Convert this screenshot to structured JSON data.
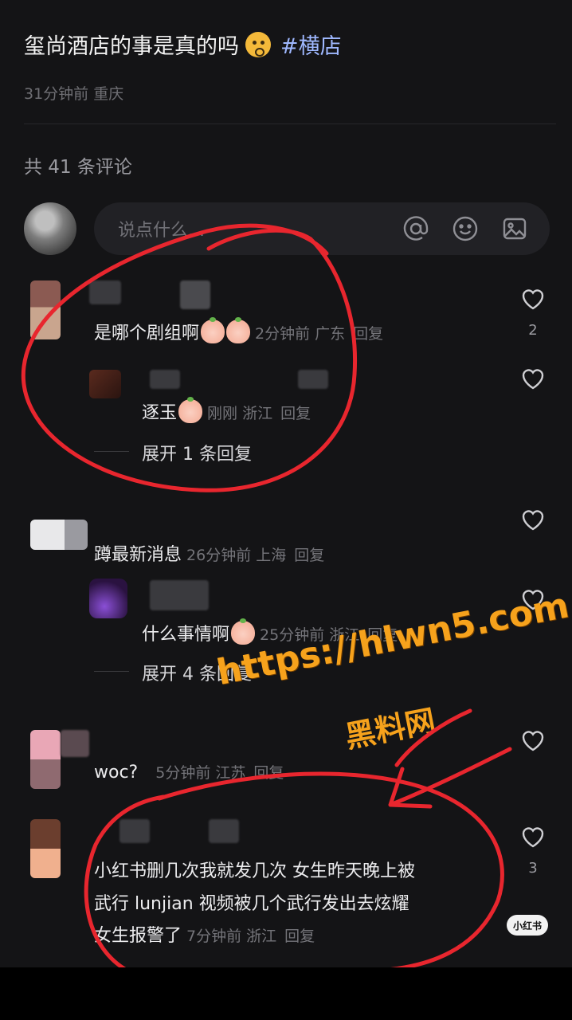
{
  "post": {
    "title": "玺尚酒店的事是真的吗",
    "tag": "#横店",
    "meta": "31分钟前 重庆"
  },
  "comments_count": "共 41 条评论",
  "input": {
    "placeholder": "说点什么...",
    "icons": [
      "at-icon",
      "emoji-icon",
      "image-icon"
    ]
  },
  "comments": [
    {
      "text": "是哪个剧组啊",
      "time": "2分钟前",
      "location": "广东",
      "reply_label": "回复",
      "likes": "2",
      "replies": [
        {
          "text": "逐玉",
          "time": "刚刚",
          "location": "浙江",
          "reply_label": "回复"
        }
      ],
      "expand_label": "展开 1 条回复"
    },
    {
      "text": "蹲最新消息",
      "time": "26分钟前",
      "location": "上海",
      "reply_label": "回复",
      "replies": [
        {
          "text": "什么事情啊",
          "time": "25分钟前",
          "location": "浙江",
          "reply_label": "回复"
        }
      ],
      "expand_label": "展开 4 条回复"
    },
    {
      "text": "woc?",
      "time": "5分钟前",
      "location": "江苏",
      "reply_label": "回复"
    },
    {
      "lines": [
        "小红书删几次我就发几次  女生昨天晚上被",
        "武行 lunjian  视频被几个武行发出去炫耀",
        "女生报警了"
      ],
      "time": "7分钟前",
      "location": "浙江",
      "reply_label": "回复",
      "likes": "3"
    }
  ],
  "watermark": {
    "url": "https://hlwn5.com",
    "name": "黑料网",
    "badge": "小红书"
  },
  "colors": {
    "background": "#141416",
    "annotation": "#e8262e",
    "watermark": "#f6a21c",
    "tag": "#9fb8ff"
  }
}
